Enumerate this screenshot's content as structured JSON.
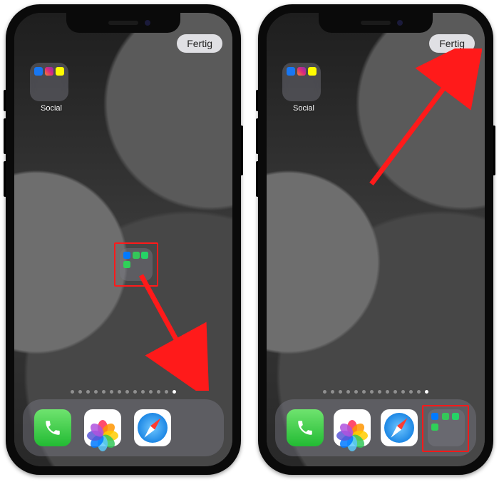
{
  "labels": {
    "done": "Fertig",
    "folder_social": "Social"
  },
  "colors": {
    "annotation": "#ff1a1a",
    "done_bg": "rgba(235,235,240,.92)"
  },
  "phones": [
    {
      "id": "step_drag",
      "homescreen_folder": {
        "name": "Social",
        "apps": [
          "facebook",
          "instagram",
          "snapchat"
        ]
      },
      "dragging_folder_apps": [
        "messenger",
        "facetime",
        "whatsapp",
        "imessage"
      ],
      "dock_apps": [
        "phone",
        "photos",
        "safari"
      ],
      "page_indicator": {
        "count": 14,
        "active_index": 13
      },
      "highlight": "drag_folder",
      "arrow": {
        "from": "drag_folder",
        "to": "dock_right"
      }
    },
    {
      "id": "step_done",
      "homescreen_folder": {
        "name": "Social",
        "apps": [
          "facebook",
          "instagram",
          "snapchat"
        ]
      },
      "dock_apps": [
        "phone",
        "photos",
        "safari",
        "chat_folder"
      ],
      "chat_folder_apps": [
        "messenger",
        "facetime",
        "whatsapp",
        "imessage"
      ],
      "page_indicator": {
        "count": 14,
        "active_index": 13
      },
      "highlight": "dock_folder",
      "arrow": {
        "from": "center",
        "to": "done_button"
      }
    }
  ]
}
